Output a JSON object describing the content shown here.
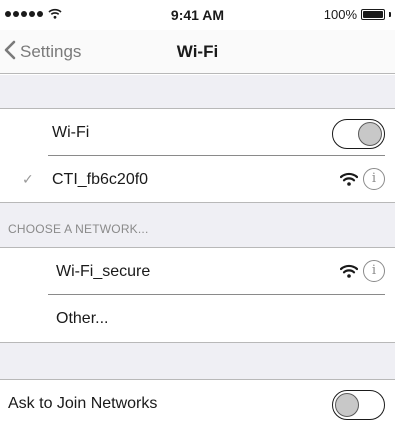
{
  "status_bar": {
    "time": "9:41 AM",
    "battery_percent": "100%",
    "signal_bars": 5,
    "icons": [
      "signal-dots-icon",
      "wifi-signal-icon",
      "battery-icon"
    ]
  },
  "nav": {
    "back_label": "Settings",
    "title": "Wi-Fi",
    "back_icon": "chevron-left-icon"
  },
  "wifi_toggle": {
    "label": "Wi-Fi",
    "state": "on"
  },
  "connected_network": {
    "name": "CTI_fb6c20f0",
    "check_icon": "checkmark-icon",
    "signal_icon": "wifi-signal-icon",
    "info_icon": "info-icon",
    "info_glyph": "i"
  },
  "section": {
    "header": "CHOOSE A NETWORK..."
  },
  "networks": [
    {
      "name": "Wi-Fi_secure",
      "signal_icon": "wifi-signal-icon",
      "info_icon": "info-icon",
      "info_glyph": "i"
    },
    {
      "name": "Other..."
    }
  ],
  "ask_to_join": {
    "label": "Ask to Join Networks",
    "state": "off"
  },
  "colors": {
    "accent_text": "#1a1a1a",
    "secondary_text": "#8a8a8a",
    "group_background": "#efeff4",
    "separator": "#b8b8b8"
  }
}
